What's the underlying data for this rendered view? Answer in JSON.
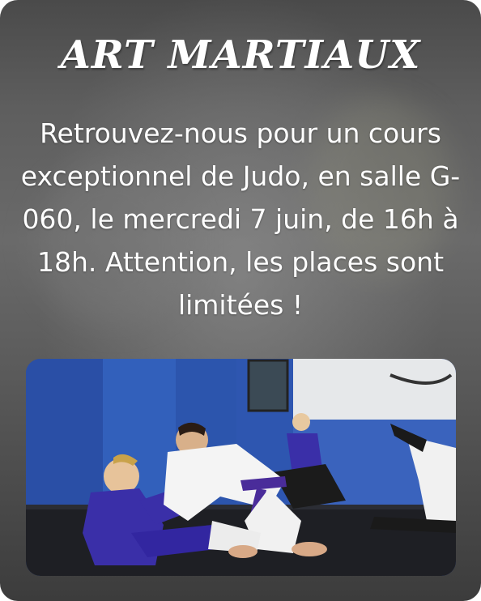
{
  "poster": {
    "title": "ART MARTIAUX",
    "description": "Retrouvez-nous pour un cours exceptionnel de Judo, en salle G-060, le mercredi 7 juin, de 16h à 18h. Attention, les places sont limitées !",
    "photo_alt": "judo-practice-photo"
  },
  "colors": {
    "card_background": "#5a5a5a",
    "text": "#ffffff",
    "mat_wall_blue": "#2e56b0",
    "gi_blue": "#3a2fa8",
    "gi_white": "#f4f4f4",
    "floor": "#1e1f24"
  }
}
